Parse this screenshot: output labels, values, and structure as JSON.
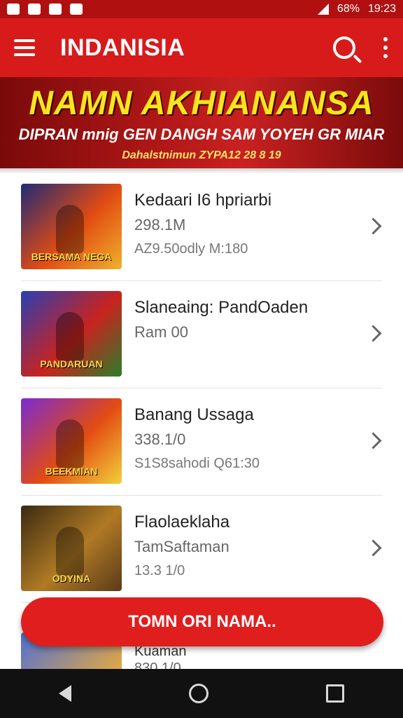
{
  "status_bar": {
    "battery": "68%",
    "time": "19:23"
  },
  "app_bar": {
    "title": "INDANISIA"
  },
  "banner": {
    "title": "NAMN AKHIANANSA",
    "subtitle": "DIPRAN mnig GEN DANGH SAM YOYEH GR MIAR",
    "small": "Dahalstnimun ZYPA12 28 8 19"
  },
  "items": [
    {
      "thumb_caption": "BERSAMA NEGA",
      "line1": "Kedaari I6 hpriarbi",
      "line2": "298.1M",
      "line3": "AZ9.50odly M:180"
    },
    {
      "thumb_caption": "PANDARUAN",
      "line1": "Slaneaing: PandOaden",
      "line2": "Ram 00",
      "line3": ""
    },
    {
      "thumb_caption": "BEEKMIAN",
      "line1": "Banang Ussaga",
      "line2": "338.1/0",
      "line3": "S1S8sahodi   Q61:30"
    },
    {
      "thumb_caption": "ODYINA",
      "line1": "Flaolaeklaha",
      "line2": "TamSaftaman",
      "line3": "13.3 1/0"
    }
  ],
  "cta": {
    "label": "TOMN ORI NAMA.."
  },
  "peek": {
    "line1": "Kuaman",
    "line2": "830 1/0"
  }
}
